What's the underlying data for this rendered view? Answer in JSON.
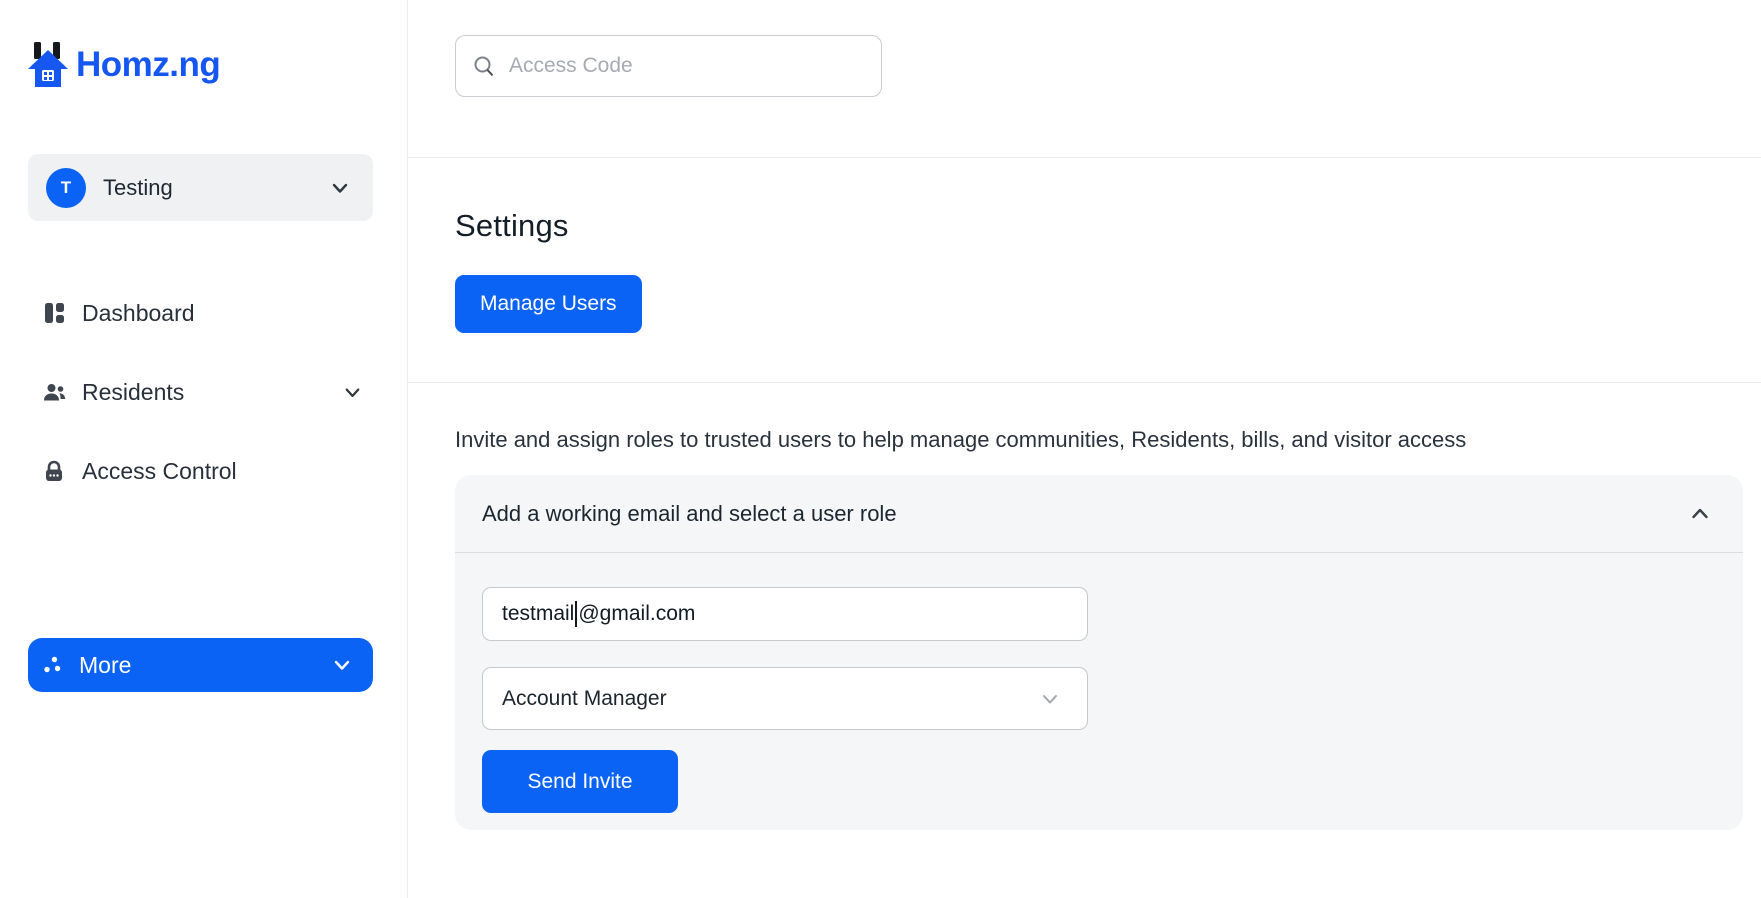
{
  "colors": {
    "accent_blue": "#0a63f5",
    "logo_blue": "#1657f2",
    "card_bg": "#f5f6f7",
    "workspace_bg": "#f0f1f3",
    "text_dark": "#1c2630",
    "placeholder_gray": "#a6abb2"
  },
  "sidebar": {
    "logo_text": "Homz.ng",
    "workspace": {
      "initial": "T",
      "name": "Testing"
    },
    "nav": [
      {
        "label": "Dashboard"
      },
      {
        "label": "Residents"
      },
      {
        "label": "Access Control"
      }
    ],
    "more_label": "More"
  },
  "header": {
    "search_placeholder": "Access Code"
  },
  "settings": {
    "title": "Settings",
    "manage_users_label": "Manage Users"
  },
  "invite": {
    "description": "Invite and assign roles to trusted users to help manage communities, Residents, bills, and visitor access",
    "card_title": "Add a working email and select a user role",
    "email_before_caret": "testmail",
    "email_after_caret": "@gmail.com",
    "role_selected": "Account Manager",
    "send_label": "Send Invite"
  }
}
